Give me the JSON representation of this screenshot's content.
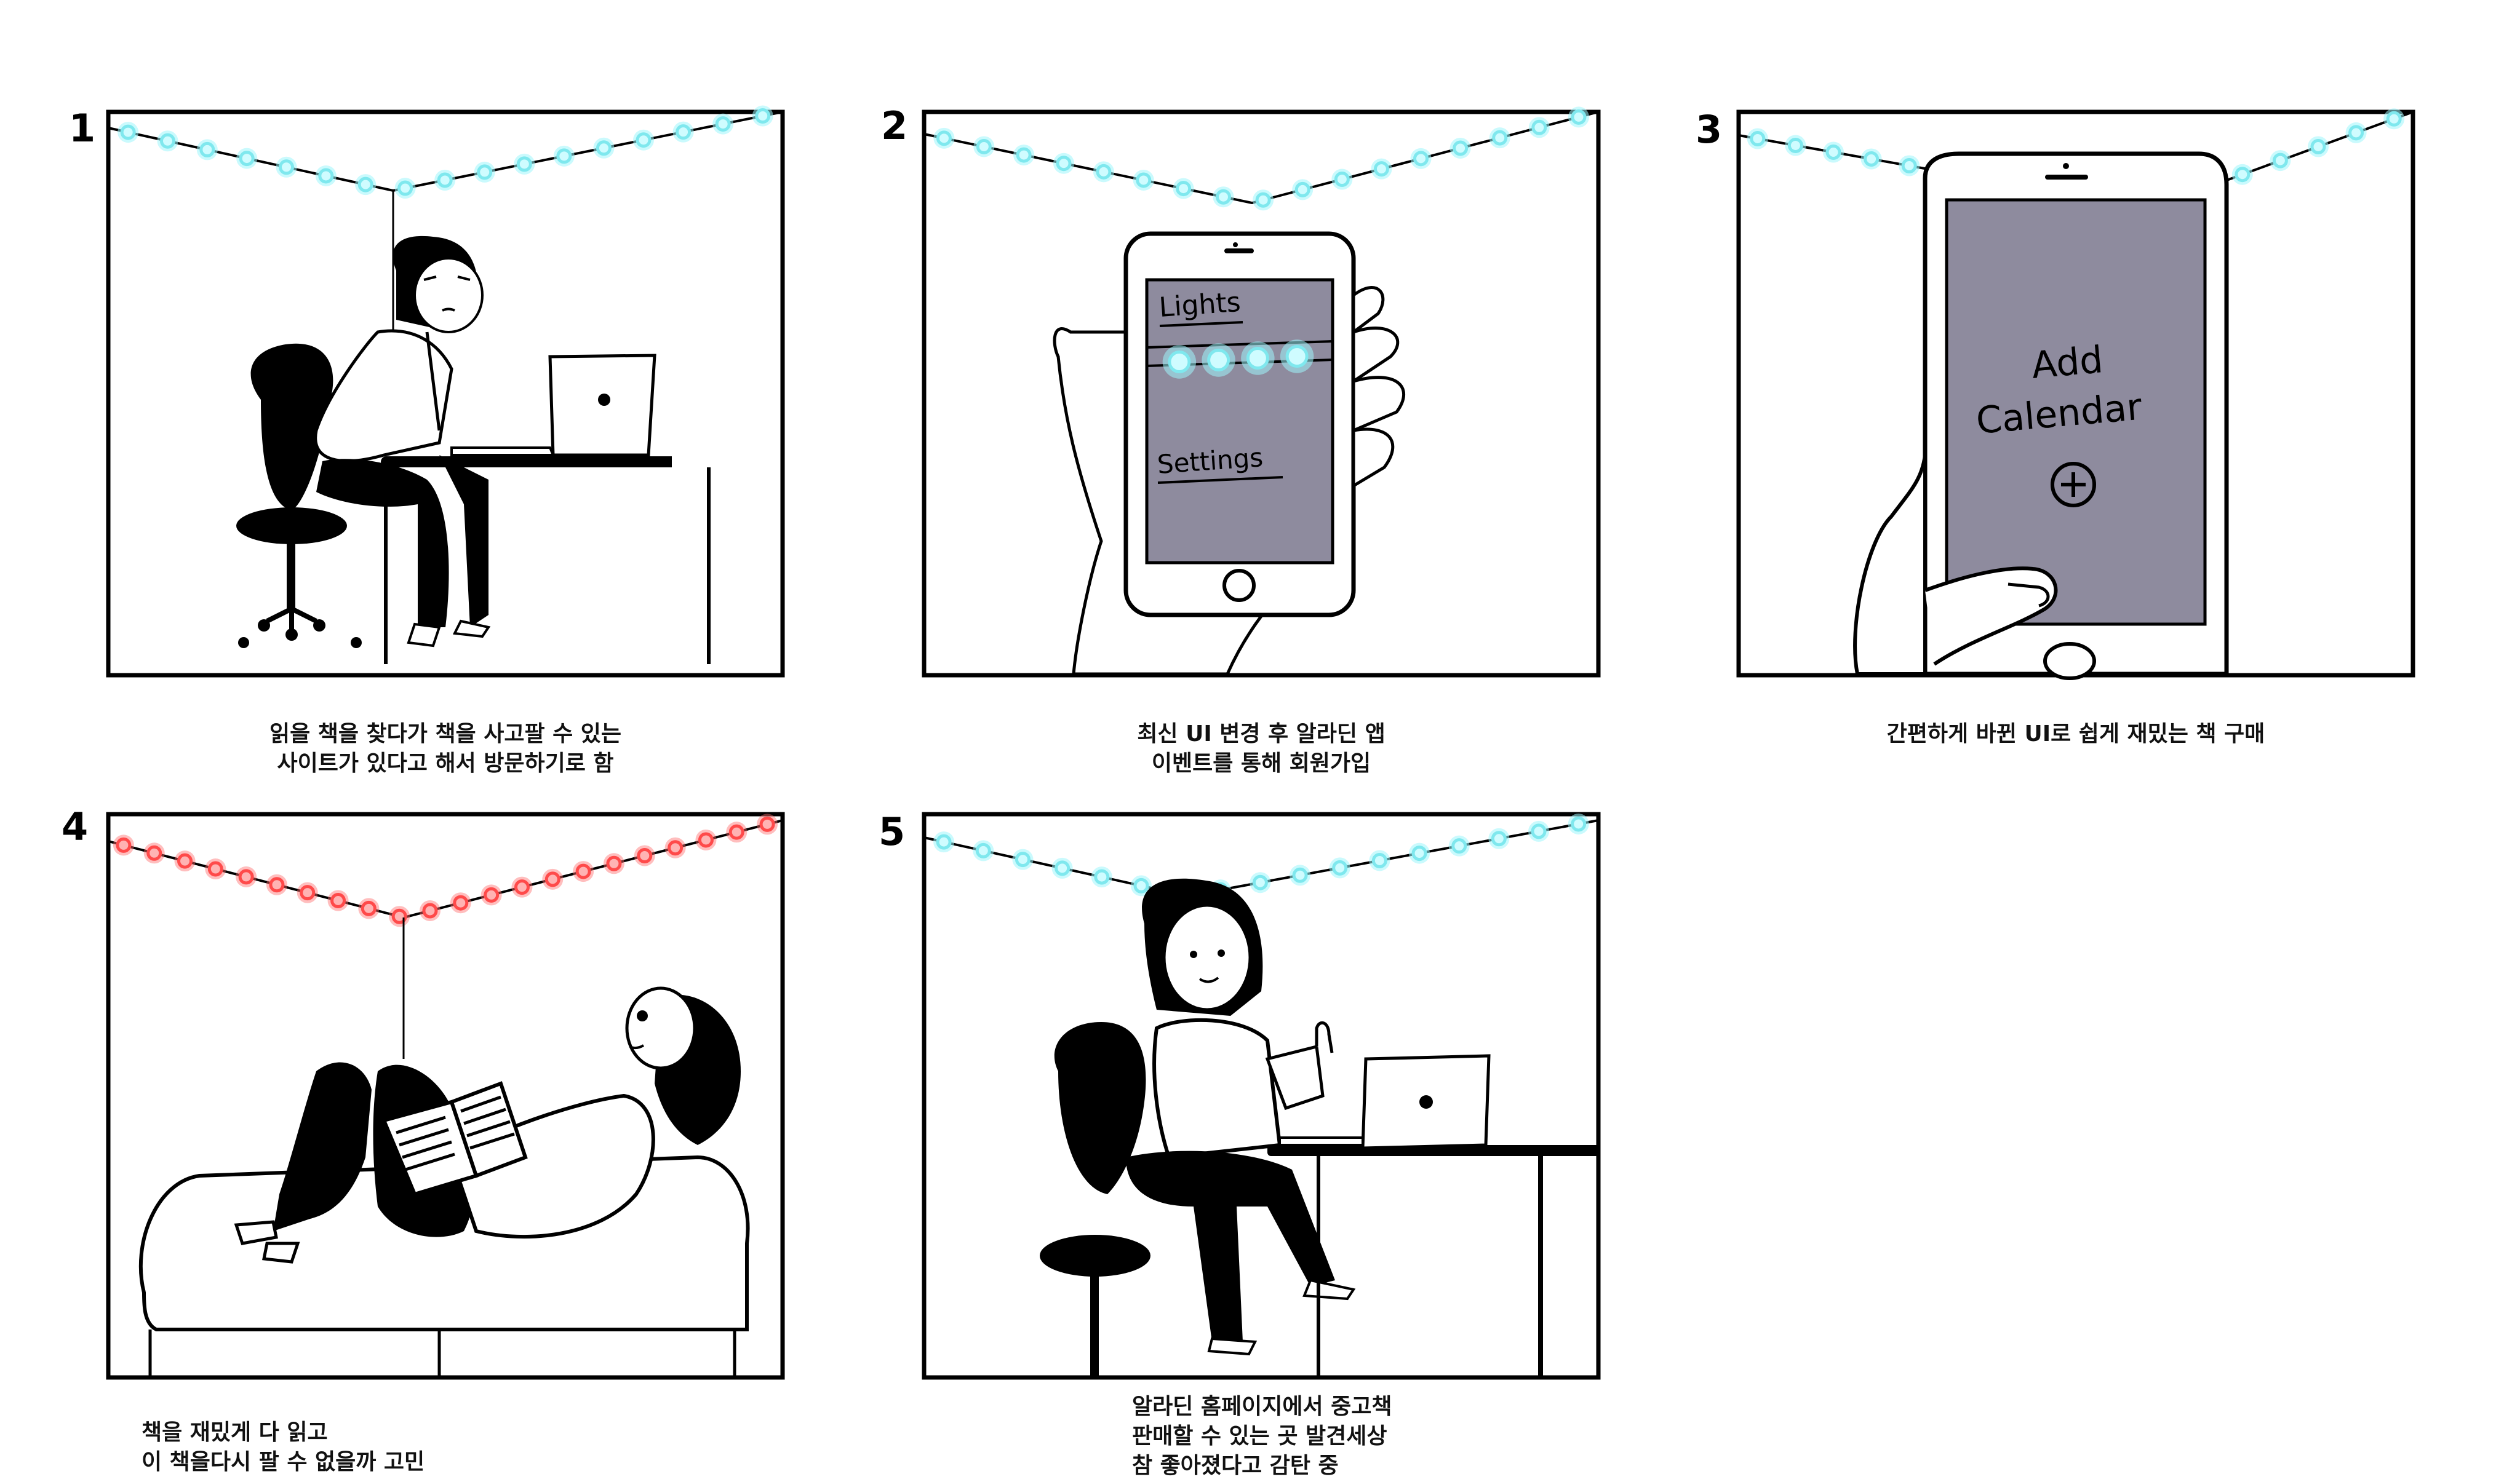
{
  "panels": [
    {
      "number": "1",
      "caption": [
        "읽을 책을 찾다가 책을 사고팔 수 있는",
        "사이트가 있다고 해서 방문하기로 함"
      ]
    },
    {
      "number": "2",
      "caption": [
        "최신 UI 변경 후 알라딘 앱",
        "이벤트를 통해 회원가입"
      ],
      "phone": {
        "menu_lights": "Lights",
        "menu_settings": "Settings"
      }
    },
    {
      "number": "3",
      "caption": [
        "간편하게 바뀐 UI로 쉽게 재밌는 책 구매"
      ],
      "phone": {
        "line1": "Add",
        "line2": "Calendar",
        "icon": "plus-circle-icon"
      }
    },
    {
      "number": "4",
      "caption": [
        "책을 재밌게 다 읽고",
        "이 책을다시 팔 수 없을까 고민"
      ]
    },
    {
      "number": "5",
      "caption": [
        "알라딘 홈페이지에서 중고책",
        "판매할 수 있는 곳 발견세상",
        "참 좋아졌다고 감탄 중"
      ]
    }
  ],
  "colors": {
    "ink": "#000000",
    "light_cyan": "#7fe8ee",
    "light_red": "#ff4a4a",
    "phone_screen": "#8e8b9e"
  }
}
